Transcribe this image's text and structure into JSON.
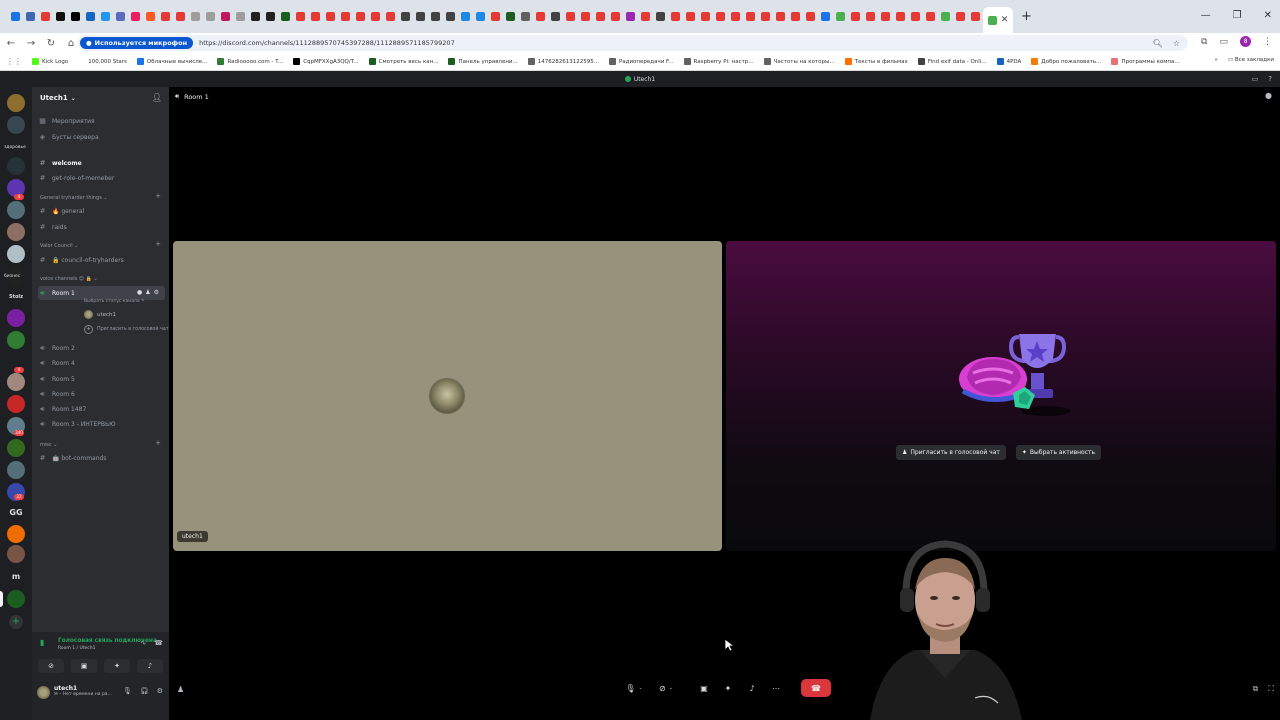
{
  "browser": {
    "tab_colors": [
      "#1a73e8",
      "#4267b2",
      "#e53935",
      "#111111",
      "#000000",
      "#1565c0",
      "#2196f3",
      "#5c6bc0",
      "#e91e63",
      "#ff5722",
      "#e53935",
      "#e53935",
      "#9e9e9e",
      "#9e9e9e",
      "#c2185b",
      "#9e9e9e",
      "#212121",
      "#212121",
      "#1b5e20",
      "#e53935",
      "#e53935",
      "#e53935",
      "#e53935",
      "#e53935",
      "#e53935",
      "#e53935",
      "#424242",
      "#424242",
      "#424242",
      "#424242",
      "#1e88e5",
      "#1e88e5",
      "#e53935",
      "#1b5e20",
      "#616161",
      "#e53935",
      "#424242",
      "#e53935",
      "#e53935",
      "#e53935",
      "#e53935",
      "#9c27b0",
      "#e53935",
      "#424242",
      "#e53935",
      "#e53935",
      "#e53935",
      "#e53935",
      "#e53935",
      "#e53935",
      "#e53935",
      "#e53935",
      "#e53935",
      "#e53935",
      "#1a73e8",
      "#4caf50",
      "#e53935",
      "#e53935",
      "#e53935",
      "#e53935",
      "#e53935",
      "#e53935",
      "#4caf50",
      "#e53935",
      "#e53935",
      "#4caf50"
    ],
    "mic_pill": "Используется микрофон",
    "url": "https://discord.com/channels/1112889570745397288/1112889571185799207",
    "profile_letter": "8",
    "bookmarks": [
      {
        "label": "Kick Logo",
        "color": "#53fc18"
      },
      {
        "label": "100,000 Stars",
        "color": "#ffffff"
      },
      {
        "label": "Облачные вычисле...",
        "color": "#1a73e8"
      },
      {
        "label": "Radiooooo.com - T...",
        "color": "#2e7d32"
      },
      {
        "label": "CqpMFXXgA3QQ/T...",
        "color": "#000000"
      },
      {
        "label": "Смотреть весь кан...",
        "color": "#1b5e20"
      },
      {
        "label": "Панель управлени...",
        "color": "#1b5e20"
      },
      {
        "label": "1476282613122595...",
        "color": "#616161"
      },
      {
        "label": "Радиопередачи F...",
        "color": "#616161"
      },
      {
        "label": "Raspberry Pi: настр...",
        "color": "#616161"
      },
      {
        "label": "Частоты на которы...",
        "color": "#616161"
      },
      {
        "label": "Тексты в фильмах",
        "color": "#ff6f00"
      },
      {
        "label": "Find exif data - Onli...",
        "color": "#424242"
      },
      {
        "label": "4PDA",
        "color": "#1565c0"
      },
      {
        "label": "Добро пожаловать...",
        "color": "#f57c00"
      },
      {
        "label": "Программы компа...",
        "color": "#e57373"
      }
    ],
    "bookmarks_right": "Все закладки"
  },
  "discord": {
    "window_title": "Utech1",
    "server_name": "Utech1",
    "servers": [
      {
        "color": "#8d6e2f",
        "label": ""
      },
      {
        "color": "#37474f",
        "label": ""
      },
      {
        "color": "#263238",
        "label": ""
      },
      {
        "color": "#5e35b1",
        "label": ""
      },
      {
        "color": "#546e7a",
        "label": ""
      },
      {
        "color": "#8d6e63",
        "label": ""
      },
      {
        "color": "#1e1f22",
        "label": "K"
      },
      {
        "color": "#b0bec5",
        "label": ""
      },
      {
        "color": "#212121",
        "label": ""
      },
      {
        "color": "#1e1f22",
        "label": "Stolz"
      },
      {
        "color": "#7b1fa2",
        "label": ""
      },
      {
        "color": "#2e7d32",
        "label": ""
      },
      {
        "color": "#a1887f",
        "label": ""
      },
      {
        "color": "#c62828",
        "label": ""
      },
      {
        "color": "#607d8b",
        "label": ""
      },
      {
        "color": "#33691e",
        "label": ""
      },
      {
        "color": "#546e7a",
        "label": ""
      },
      {
        "color": "#3949ab",
        "label": ""
      },
      {
        "color": "#1e1f22",
        "label": "GG"
      },
      {
        "color": "#ef6c00",
        "label": ""
      },
      {
        "color": "#795548",
        "label": ""
      },
      {
        "color": "#1e1f22",
        "label": "m"
      },
      {
        "color": "#1b5e20",
        "label": ""
      }
    ],
    "badges": {
      "b1": "4",
      "b2": "4",
      "b3": "340",
      "b4": "22"
    },
    "rail_labels": {
      "l1": "здоровье",
      "l2": "бизнес"
    },
    "sidebar": {
      "top_items": [
        {
          "icon": "▦",
          "label": "Мероприятия"
        },
        {
          "icon": "◈",
          "label": "Бусты сервера"
        }
      ],
      "welcome": "welcome",
      "get_role": "get-role-of-memeber",
      "cat_general": "General tryharder things ⌄",
      "general": "🔥 general",
      "raids": "raids",
      "cat_valor": "Valor Council ⌄",
      "council": "🔒 council-of-tryharders",
      "cat_voice": "voice channels 😊 🔒 ⌄",
      "room1": "Room 1",
      "room1_status": "Выбрать статус канала ✎",
      "room1_user": "utech1",
      "invite_voice": "Пригласить в голосовой чат",
      "rooms": [
        "Room 2",
        "Room 4",
        "Room 5",
        "Room 6",
        "Room 1487",
        "Room 3 - ИНТЕРВЬЮ"
      ],
      "cat_misc": "misc ⌄",
      "bot_commands": "🤖 bot-commands"
    },
    "voice_panel": {
      "status": "Голосовая связь подключена",
      "room": "Room 1 / Utech1"
    },
    "user_panel": {
      "name": "utech1",
      "sub": "✉ – Нет времени на ра..."
    },
    "call": {
      "title": "Room 1",
      "tile_name": "utech1",
      "invite_btn": "Пригласить в голосовой чат",
      "activity_btn": "Выбрать активность"
    }
  }
}
